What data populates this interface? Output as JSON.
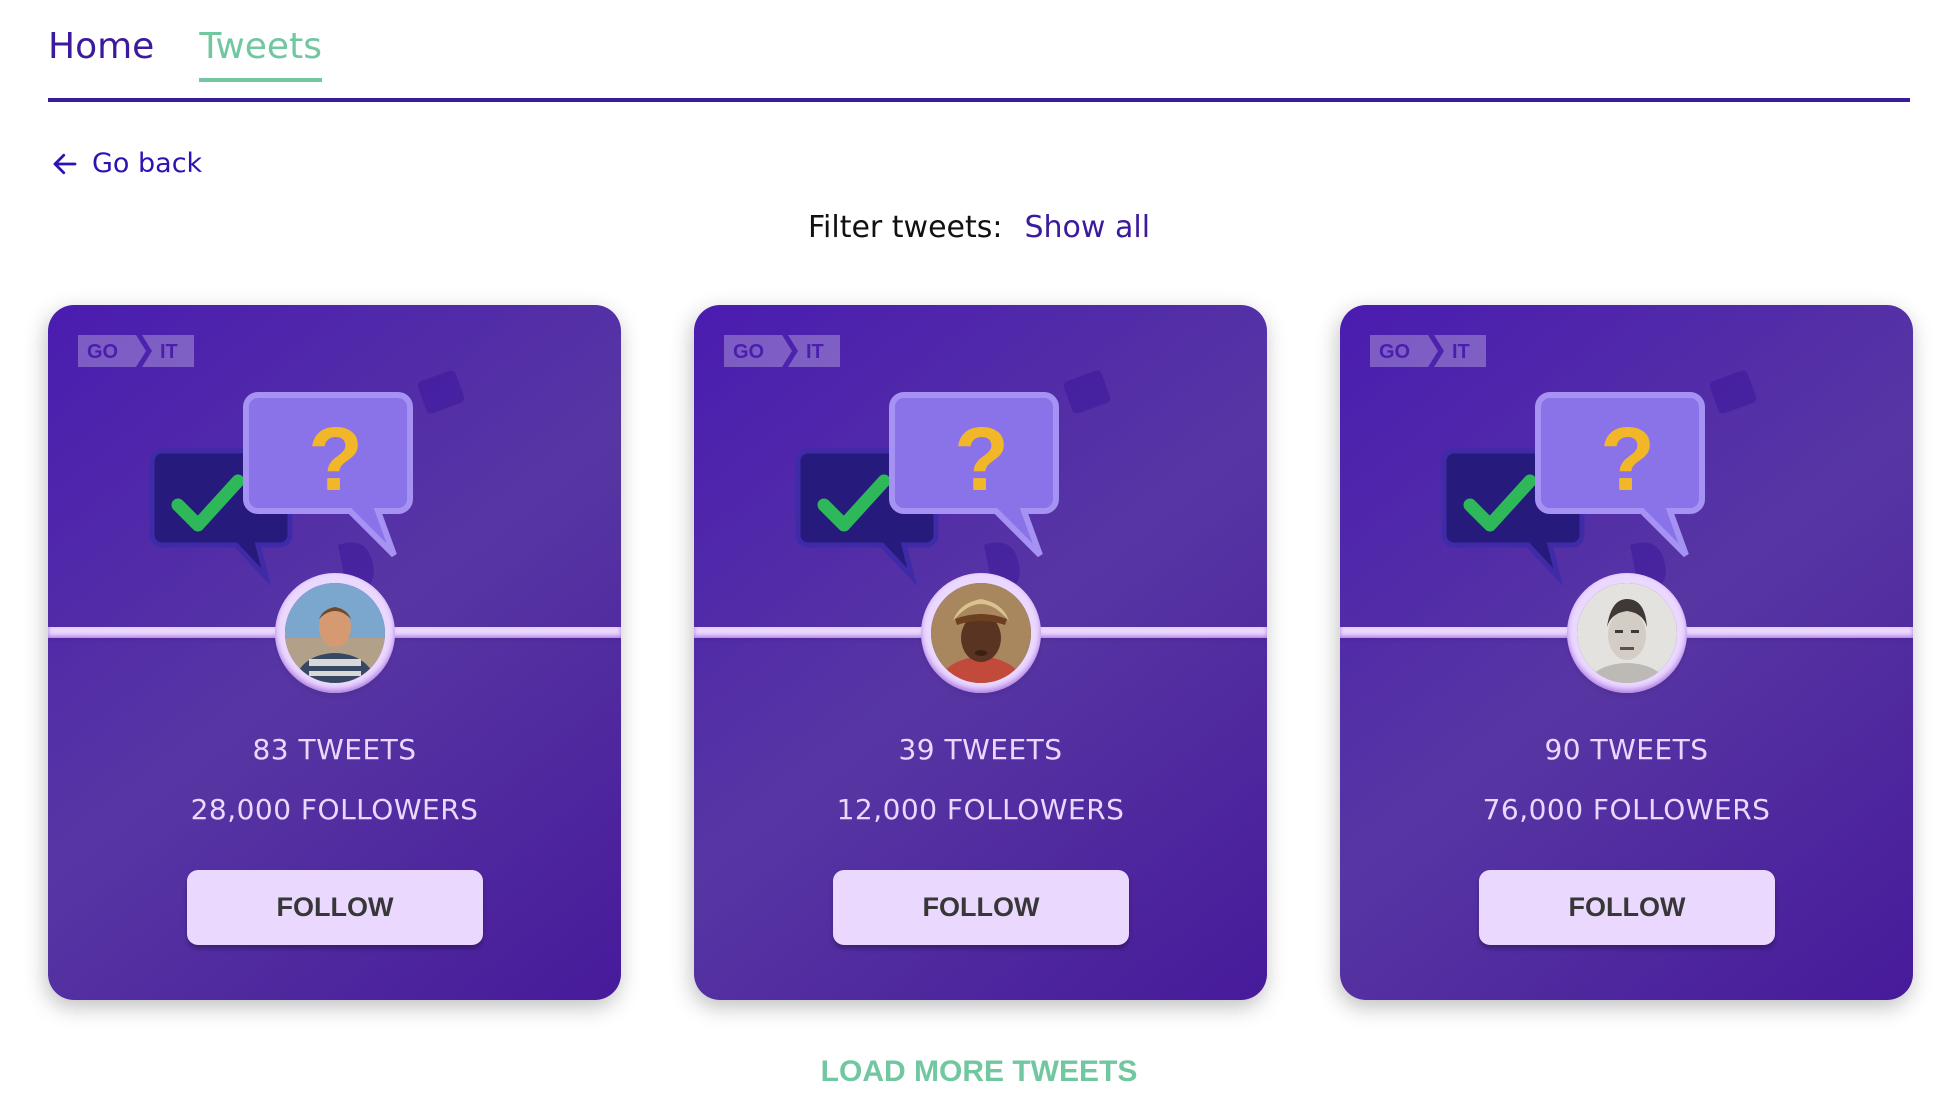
{
  "nav": {
    "items": [
      {
        "label": "Home",
        "active": false
      },
      {
        "label": "Tweets",
        "active": true
      }
    ]
  },
  "go_back": {
    "label": "Go back",
    "icon": "arrow-left-icon"
  },
  "filter": {
    "label": "Filter tweets:",
    "value": "Show all"
  },
  "card_logo": {
    "left": "GO",
    "right": "IT"
  },
  "cards": [
    {
      "tweets": "83 TWEETS",
      "followers": "28,000 FOLLOWERS",
      "button": "FOLLOW"
    },
    {
      "tweets": "39 TWEETS",
      "followers": "12,000 FOLLOWERS",
      "button": "FOLLOW"
    },
    {
      "tweets": "90 TWEETS",
      "followers": "76,000 FOLLOWERS",
      "button": "FOLLOW"
    }
  ],
  "load_more": "LOAD MORE TWEETS",
  "colors": {
    "accent_green": "#71c7a0",
    "brand_purple": "#3b1a9e",
    "card_bg": "#5736a3",
    "light_lilac": "#ebd8ff"
  }
}
